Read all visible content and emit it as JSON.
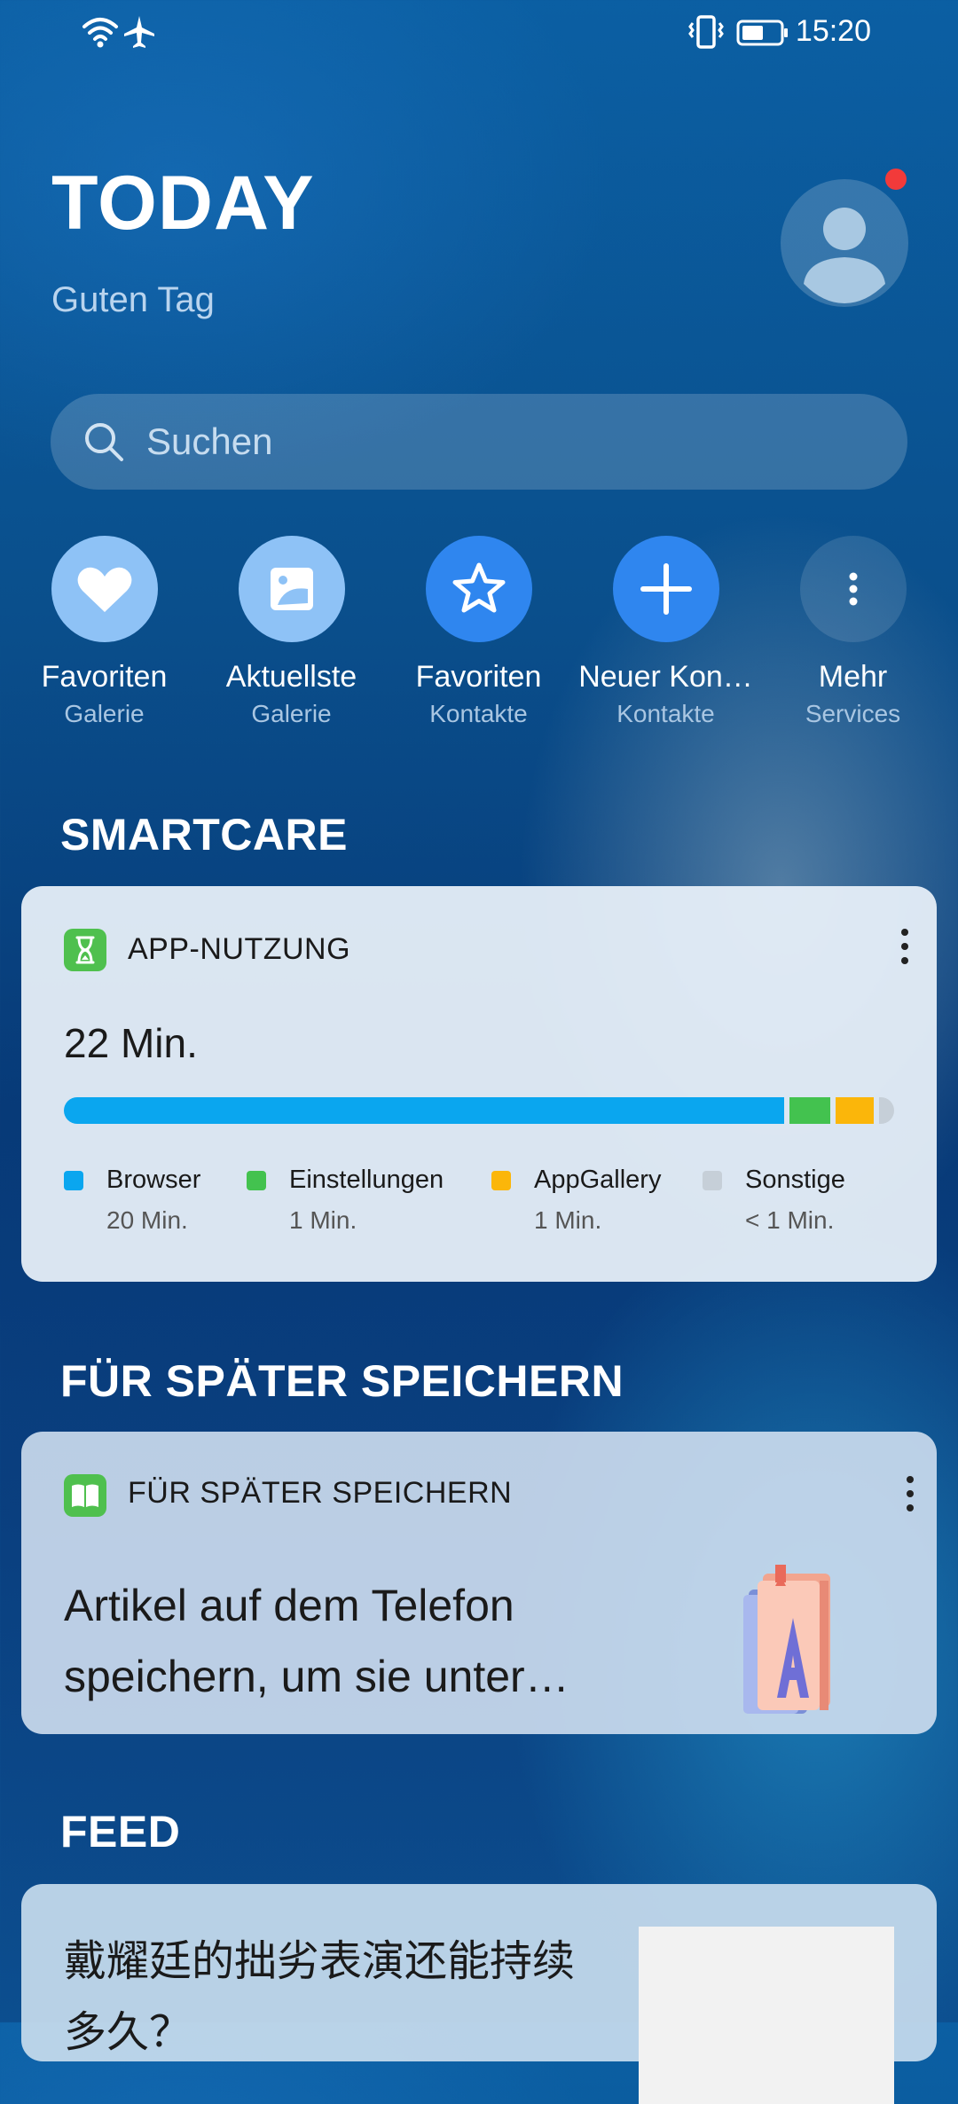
{
  "status_bar": {
    "time": "15:20",
    "icons": [
      "wifi-icon",
      "airplane-icon",
      "vibrate-icon",
      "battery-icon"
    ]
  },
  "header": {
    "title": "TODAY",
    "greeting": "Guten Tag"
  },
  "search": {
    "placeholder": "Suchen"
  },
  "shortcuts": [
    {
      "label": "Favoriten",
      "sub": "Galerie",
      "icon": "heart-icon",
      "color": "#8ec2f6"
    },
    {
      "label": "Aktuellste",
      "sub": "Galerie",
      "icon": "photo-icon",
      "color": "#8ec2f6"
    },
    {
      "label": "Favoriten",
      "sub": "Kontakte",
      "icon": "star-icon",
      "color": "#2f86ef"
    },
    {
      "label": "Neuer Kon…",
      "sub": "Kontakte",
      "icon": "plus-icon",
      "color": "#2f86ef"
    },
    {
      "label": "Mehr",
      "sub": "Services",
      "icon": "more-vertical-icon",
      "color": "#2c6fa8"
    }
  ],
  "smartcare": {
    "section_title": "SMARTCARE",
    "card_title": "APP-NUTZUNG",
    "total": "22 Min.",
    "items": [
      {
        "name": "Browser",
        "time": "20 Min.",
        "color": "#0aa6ef",
        "fraction": 0.885
      },
      {
        "name": "Einstellungen",
        "time": "1 Min.",
        "color": "#43c24f",
        "fraction": 0.05
      },
      {
        "name": "AppGallery",
        "time": "1 Min.",
        "color": "#fbb60a",
        "fraction": 0.047
      },
      {
        "name": "Sonstige",
        "time": "< 1 Min.",
        "color": "#c6cfd8",
        "fraction": 0.018
      }
    ]
  },
  "save_later": {
    "section_title": "FÜR SPÄTER SPEICHERN",
    "card_title": "FÜR SPÄTER SPEICHERN",
    "text": "Artikel auf dem Telefon speichern, um sie unter…"
  },
  "feed": {
    "section_title": "FEED",
    "headline": "戴耀廷的拙劣表演还能持续多久？"
  }
}
